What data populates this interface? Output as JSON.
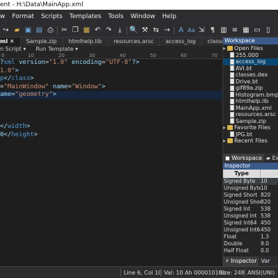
{
  "window": {
    "title": "ent - H:\\Data\\MainApp.xml"
  },
  "menu": [
    "w",
    "Format",
    "Scripts",
    "Templates",
    "Tools",
    "Window",
    "Help"
  ],
  "tabs": {
    "items": [
      {
        "label": "ml ✕",
        "active": true
      },
      {
        "label": "Sample.zip"
      },
      {
        "label": "htmlhelp.lib"
      },
      {
        "label": "resources.arsc"
      },
      {
        "label": "access_log"
      },
      {
        "label": "classes"
      }
    ]
  },
  "subbar": {
    "script": "n Script ▾",
    "template": "Run Template ▾"
  },
  "ruler": [
    "0",
    "10",
    "20",
    "30",
    "40",
    "50",
    "60",
    "70"
  ],
  "editor": {
    "lines": [
      [
        {
          "t": "?",
          "c": "pun"
        },
        {
          "t": "xml ",
          "c": "tag"
        },
        {
          "t": "version",
          "c": "attr"
        },
        {
          "t": "=",
          "c": "txtc"
        },
        {
          "t": "\"1.0\"",
          "c": "str"
        },
        {
          "t": " encoding",
          "c": "attr"
        },
        {
          "t": "=",
          "c": "txtc"
        },
        {
          "t": "\"UTF-8\"",
          "c": "str"
        },
        {
          "t": "?>",
          "c": "pun"
        }
      ],
      [
        {
          "t": "1.0\"",
          "c": "str"
        },
        {
          "t": ">",
          "c": "pun"
        }
      ],
      [
        {
          "t": "p",
          "c": "tag"
        },
        {
          "t": "</",
          "c": "pun"
        },
        {
          "t": "class",
          "c": "tag"
        },
        {
          "t": ">",
          "c": "pun"
        }
      ],
      [
        {
          "t": "=",
          "c": "txtc"
        },
        {
          "t": "\"MainWindow\"",
          "c": "str"
        },
        {
          "t": " name",
          "c": "attr"
        },
        {
          "t": "=",
          "c": "txtc"
        },
        {
          "t": "\"Window\"",
          "c": "str"
        },
        {
          "t": ">",
          "c": "pun"
        }
      ],
      [
        {
          "t": "ame",
          "c": "attr"
        },
        {
          "t": "=",
          "c": "txtc"
        },
        {
          "t": "\"geometry\"",
          "c": "str"
        },
        {
          "t": ">",
          "c": "pun"
        }
      ],
      [],
      [],
      [],
      [
        {
          "t": "</",
          "c": "pun"
        },
        {
          "t": "width",
          "c": "tag"
        },
        {
          "t": ">",
          "c": "pun"
        }
      ],
      [
        {
          "t": "0</",
          "c": "pun"
        },
        {
          "t": "height",
          "c": "tag"
        },
        {
          "t": ">",
          "c": "pun"
        }
      ]
    ],
    "highlighted_line": 4
  },
  "workspace": {
    "title": "Workspace",
    "open_files_label": "Open Files",
    "files": [
      "255.000",
      "access_log",
      "AVI.bt",
      "classes.dex",
      "Drive.bt",
      "gif89a.zip",
      "Histogram.bmp",
      "htmlhelp.lib",
      "MainApp.xml",
      "resources.arsc",
      "Sample.zip"
    ],
    "selected_file": "access_log",
    "favorites_label": "Favorite Files",
    "favorites": [
      "JPG.bt"
    ],
    "recent_label": "Recent Files",
    "tabs": [
      "Workspace",
      "Ex"
    ]
  },
  "inspector": {
    "title": "Inspector",
    "header": {
      "type": "Type",
      "value": ""
    },
    "rows": [
      {
        "type": "Signed Byte",
        "value": "10"
      },
      {
        "type": "Unsigned Byte",
        "value": "10"
      },
      {
        "type": "Signed Short",
        "value": "820"
      },
      {
        "type": "Unsigned Short",
        "value": "820"
      },
      {
        "type": "Signed Int",
        "value": "538"
      },
      {
        "type": "Unsigned Int",
        "value": "538"
      },
      {
        "type": "Signed Int64",
        "value": "450"
      },
      {
        "type": "Unsigned Int64",
        "value": "450"
      },
      {
        "type": "Float",
        "value": "1.3"
      },
      {
        "type": "Double",
        "value": "9.0"
      },
      {
        "type": "Half Float",
        "value": "0.0"
      }
    ],
    "bottom_tabs": [
      "⚡ Inspector",
      "Var"
    ]
  },
  "status": {
    "position": "Line 6, Col 10",
    "value": "Val: 10 Ah 00001010b",
    "size": "Size: 248",
    "encoding": "ANSI(UNI)"
  }
}
